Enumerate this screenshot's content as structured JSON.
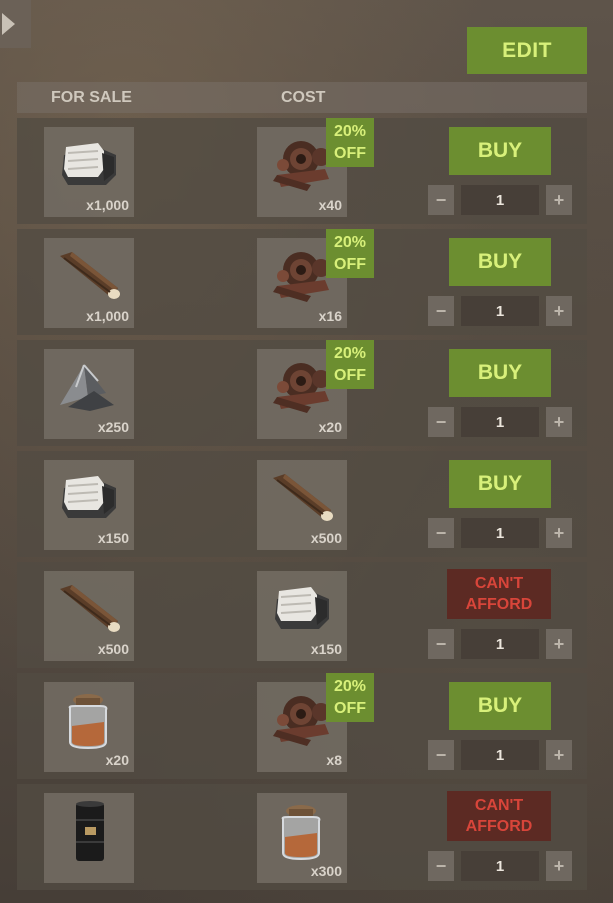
{
  "edit_label": "EDIT",
  "headers": {
    "for_sale": "FOR SALE",
    "cost": "COST"
  },
  "colors": {
    "accent": "#6c8e30",
    "accent_text": "#d8f07a",
    "cant_bg": "#5c2a23",
    "cant_text": "#d8453a"
  },
  "rows": [
    {
      "sale_icon": "cloth-icon",
      "sale_qty": "x1,000",
      "cost_icon": "scrap-icon",
      "cost_qty": "x40",
      "discount": [
        "20%",
        "OFF"
      ],
      "action": "BUY",
      "quantity": "1"
    },
    {
      "sale_icon": "wood-icon",
      "sale_qty": "x1,000",
      "cost_icon": "scrap-icon",
      "cost_qty": "x16",
      "discount": [
        "20%",
        "OFF"
      ],
      "action": "BUY",
      "quantity": "1"
    },
    {
      "sale_icon": "metal-fragments-icon",
      "sale_qty": "x250",
      "cost_icon": "scrap-icon",
      "cost_qty": "x20",
      "discount": [
        "20%",
        "OFF"
      ],
      "action": "BUY",
      "quantity": "1"
    },
    {
      "sale_icon": "cloth-icon",
      "sale_qty": "x150",
      "cost_icon": "wood-icon",
      "cost_qty": "x500",
      "discount": null,
      "action": "BUY",
      "quantity": "1"
    },
    {
      "sale_icon": "wood-icon",
      "sale_qty": "x500",
      "cost_icon": "cloth-icon",
      "cost_qty": "x150",
      "discount": null,
      "action": [
        "CAN'T",
        "AFFORD"
      ],
      "quantity": "1"
    },
    {
      "sale_icon": "jar-icon",
      "sale_qty": "x20",
      "cost_icon": "scrap-icon",
      "cost_qty": "x8",
      "discount": [
        "20%",
        "OFF"
      ],
      "action": "BUY",
      "quantity": "1"
    },
    {
      "sale_icon": "oil-barrel-icon",
      "sale_qty": "",
      "cost_icon": "jar-icon",
      "cost_qty": "x300",
      "discount": null,
      "action": [
        "CAN'T",
        "AFFORD"
      ],
      "quantity": "1"
    }
  ],
  "stepper": {
    "minus": "−",
    "plus": "+"
  }
}
